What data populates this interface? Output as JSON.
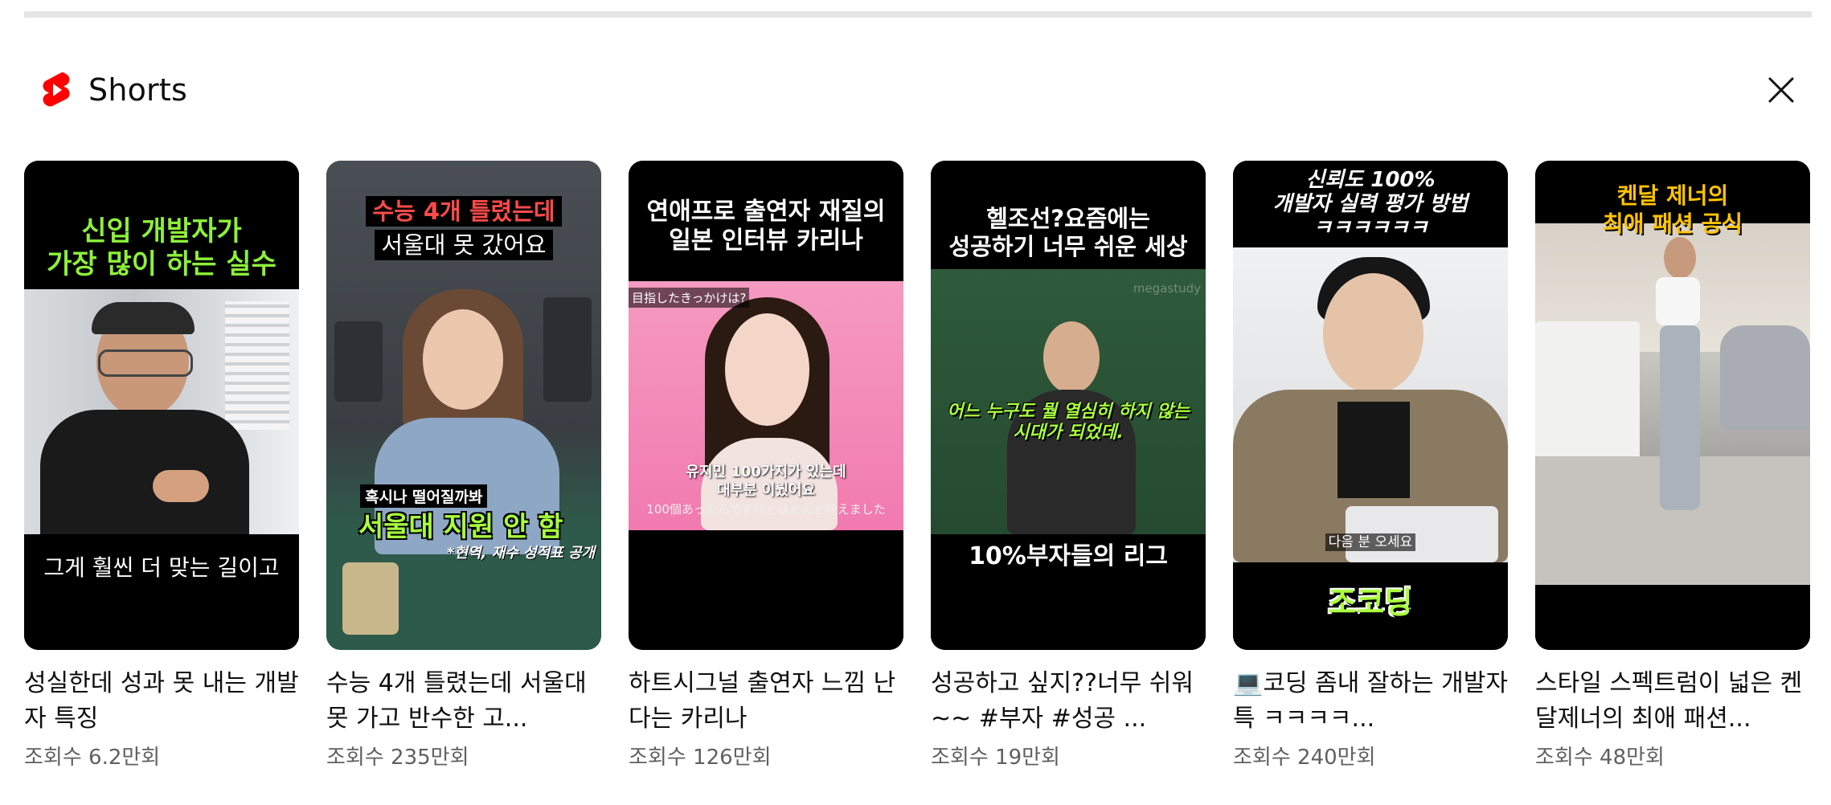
{
  "section": {
    "title": "Shorts",
    "logo_icon": "youtube-shorts-icon",
    "close_icon": "close-icon",
    "accent": "#ff0000"
  },
  "shorts": [
    {
      "title": "성실한데 성과 못 내는 개발자 특징",
      "views": "조회수 6.2만회",
      "thumb_caption_top": "신입 개발자가\n가장 많이 하는 실수",
      "thumb_caption_bottom": "그게 훨씬 더 맞는 길이고"
    },
    {
      "title": "수능 4개 틀렸는데 서울대 못 가고 반수한 고...",
      "views": "조회수 235만회",
      "thumb_caption_top_1": "수능 4개 틀렸는데",
      "thumb_caption_top_2": "서울대 못 갔어요",
      "thumb_subcaption_small": "혹시나 떨어질까봐",
      "thumb_subcaption_big": "서울대 지원 안 함",
      "thumb_note": "*현역, 재수 성적표 공개"
    },
    {
      "title": "하트시그널 출연자 느낌 난다는 카리나",
      "views": "조회수 126만회",
      "thumb_caption_top": "연애프로 출연자 재질의\n일본 인터뷰 카리나",
      "thumb_jp_tag": "目指したきっかけは?",
      "thumb_sub_1": "유지민 100가지가 있는데",
      "thumb_sub_2": "대부분 이뤘어요",
      "thumb_sub_jp": "100個あったんですけどほとんど叶えました"
    },
    {
      "title": "성공하고 싶지??너무 쉬워~~ #부자 #성공 ...",
      "views": "조회수 19만회",
      "thumb_caption_top": "헬조선?요즘에는\n성공하기 너무 쉬운 세상",
      "thumb_watermark": "megastudy",
      "thumb_sub": "어느 누구도 뭘 열심히 하지 않는\n시대가 되었데.",
      "thumb_caption_bottom": "10%부자들의 리그"
    },
    {
      "title": "💻코딩 좀내 잘하는 개발자 특 ㅋㅋㅋㅋ...",
      "views": "조회수 240만회",
      "thumb_caption_top": "신뢰도 100%\n개발자 실력 평가 방법\nㅋㅋㅋㅋㅋㅋ",
      "thumb_sub": "다음 분 오세요",
      "thumb_caption_bottom": "조코딩"
    },
    {
      "title": "스타일 스펙트럼이 넓은 켄달제너의 최애 패션...",
      "views": "조회수 48만회",
      "thumb_caption_top": "켄달 제너의\n최애 패션 공식"
    }
  ]
}
